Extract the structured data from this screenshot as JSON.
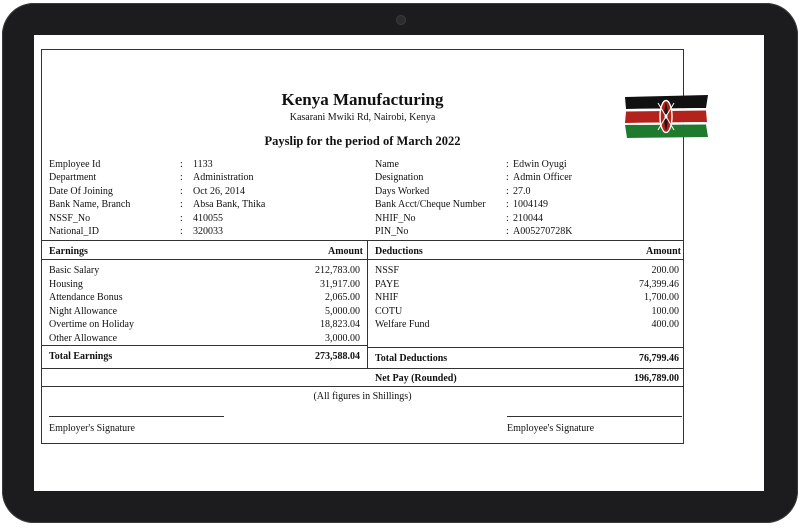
{
  "payslip": {
    "company_name": "Kenya Manufacturing",
    "address": "Kasarani Mwiki Rd, Nairobi, Kenya",
    "period_title": "Payslip for the period of March 2022",
    "flag_colors": {
      "black": "#111111",
      "red": "#b3231b",
      "green": "#1f7a2e",
      "white": "#ffffff"
    },
    "employee_left": [
      {
        "label": "Employee Id",
        "value": "1133"
      },
      {
        "label": "Department",
        "value": "Administration"
      },
      {
        "label": "Date Of Joining",
        "value": "Oct 26, 2014"
      },
      {
        "label": "Bank Name, Branch",
        "value": "Absa Bank, Thika"
      },
      {
        "label": "NSSF_No",
        "value": "410055"
      },
      {
        "label": "National_ID",
        "value": "320033"
      }
    ],
    "employee_right": [
      {
        "label": "Name",
        "value": "Edwin Oyugi"
      },
      {
        "label": "Designation",
        "value": "Admin Officer"
      },
      {
        "label": "Days Worked",
        "value": "27.0"
      },
      {
        "label": "Bank Acct/Cheque Number",
        "value": "1004149"
      },
      {
        "label": "NHIF_No",
        "value": "210044"
      },
      {
        "label": "PIN_No",
        "value": "A005270728K"
      }
    ],
    "earnings_header": "Earnings",
    "deductions_header": "Deductions",
    "amount_header": "Amount",
    "earnings": [
      {
        "name": "Basic Salary",
        "amount": "212,783.00"
      },
      {
        "name": "Housing",
        "amount": "31,917.00"
      },
      {
        "name": "Attendance Bonus",
        "amount": "2,065.00"
      },
      {
        "name": "Night Allowance",
        "amount": "5,000.00"
      },
      {
        "name": "Overtime on Holiday",
        "amount": "18,823.04"
      },
      {
        "name": "Other Allowance",
        "amount": "3,000.00"
      }
    ],
    "deductions": [
      {
        "name": "NSSF",
        "amount": "200.00"
      },
      {
        "name": "PAYE",
        "amount": "74,399.46"
      },
      {
        "name": "NHIF",
        "amount": "1,700.00"
      },
      {
        "name": "COTU",
        "amount": "100.00"
      },
      {
        "name": "Welfare Fund",
        "amount": "400.00"
      }
    ],
    "total_earnings_label": "Total Earnings",
    "total_earnings": "273,588.04",
    "total_deductions_label": "Total Deductions",
    "total_deductions": "76,799.46",
    "net_pay_label": "Net Pay (Rounded)",
    "net_pay": "196,789.00",
    "figures_note": "(All figures in Shillings)",
    "employer_signature": "Employer's Signature",
    "employee_signature": "Employee's Signature"
  }
}
